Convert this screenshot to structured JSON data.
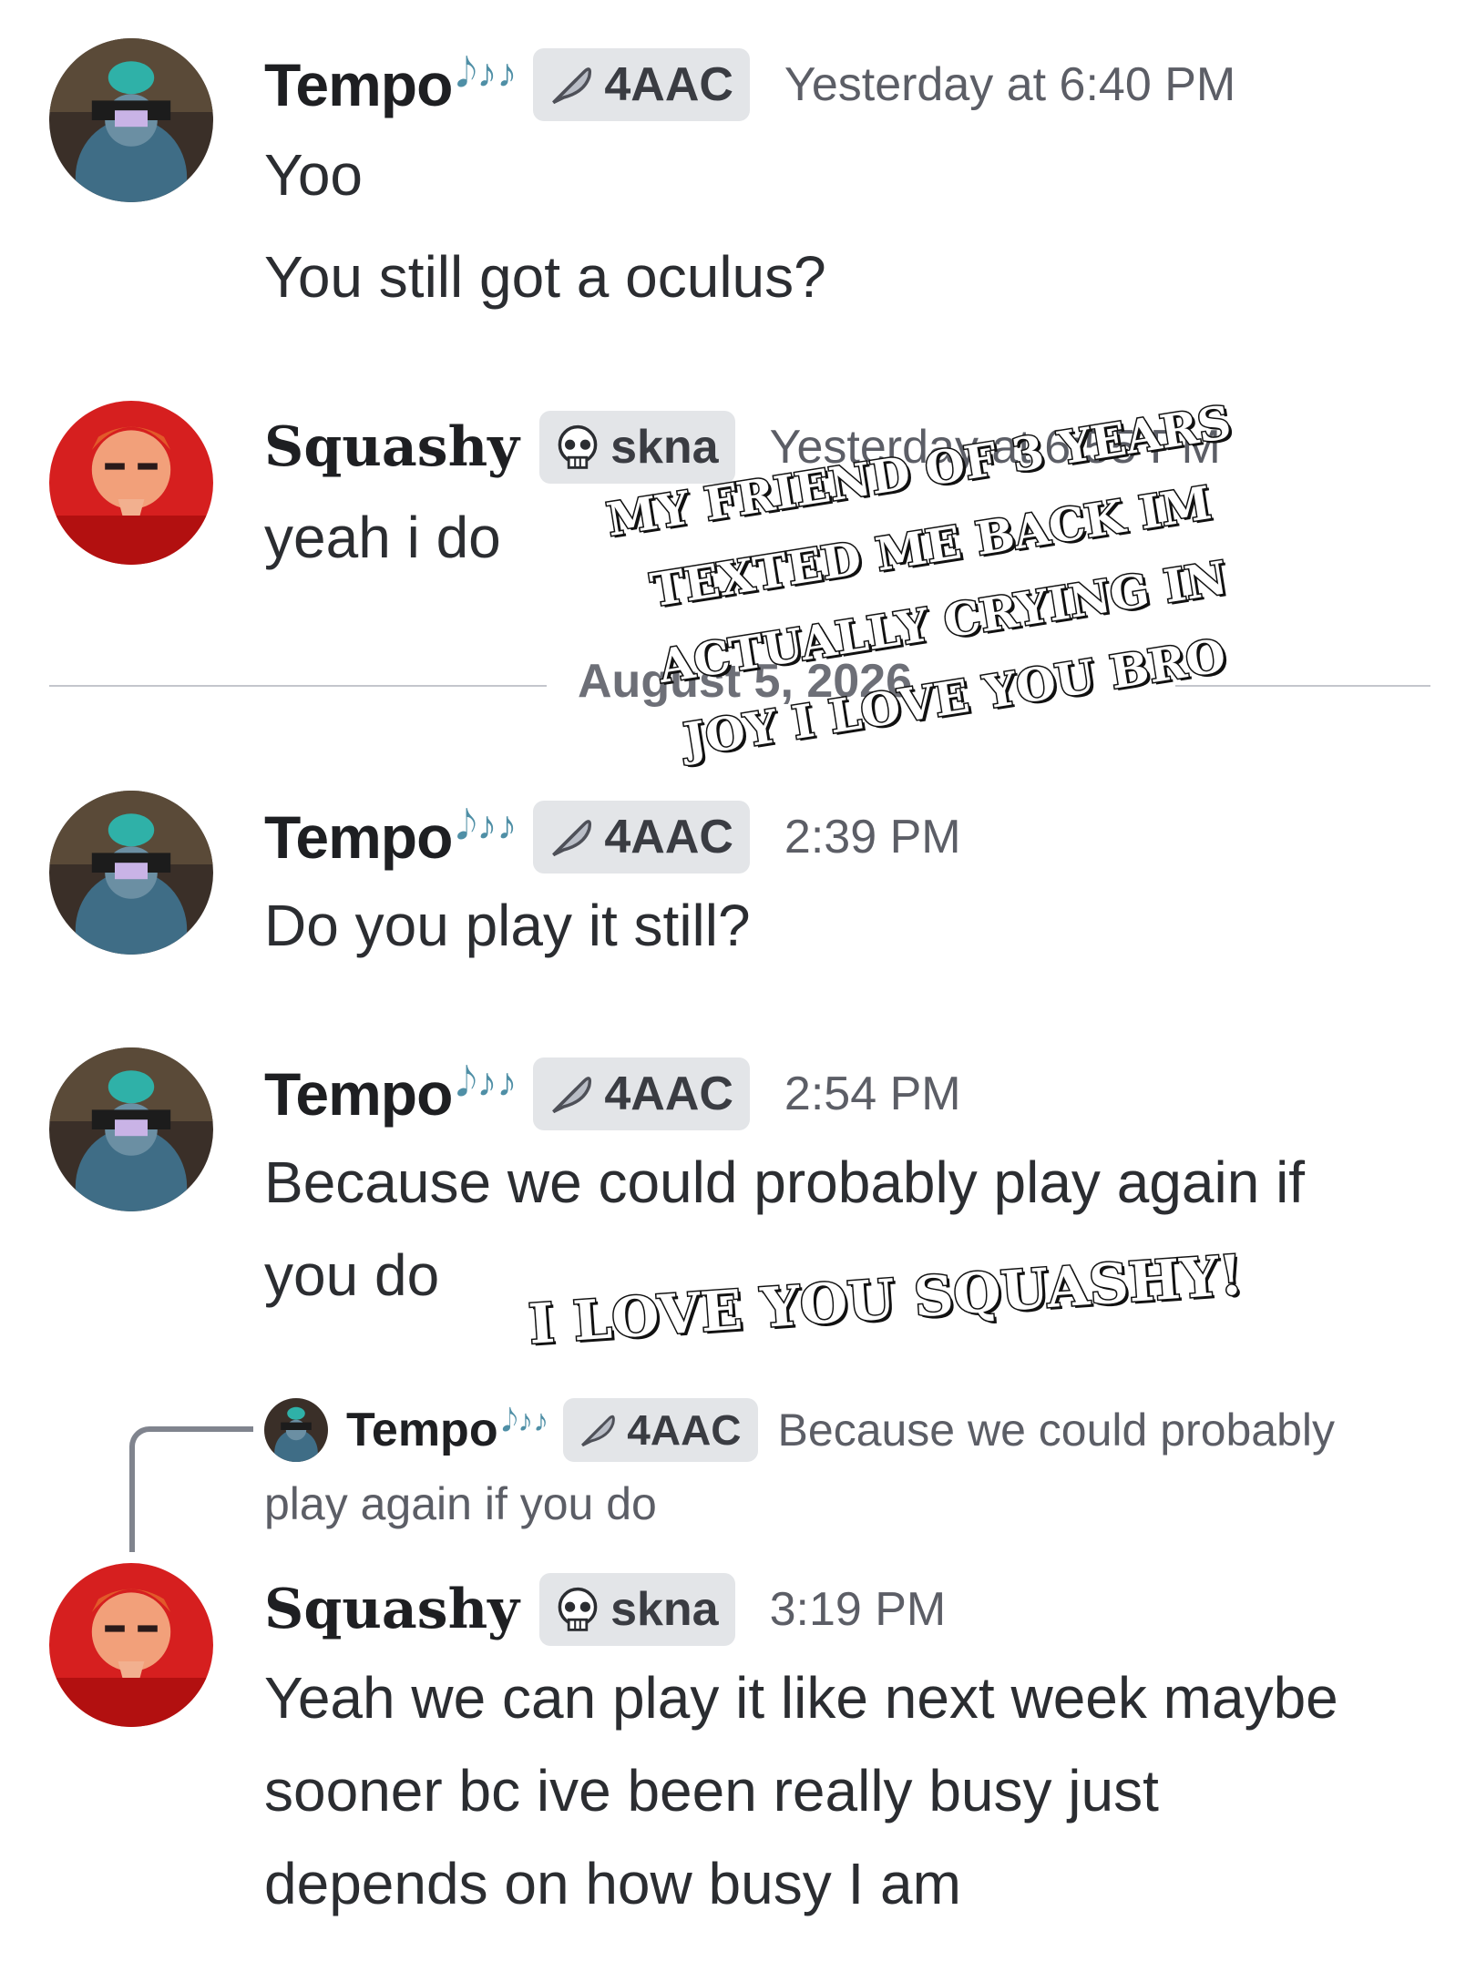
{
  "messages": [
    {
      "user": "Tempo",
      "notes": "𝅘𝅥𝅮♪♪",
      "tag": "4AAC",
      "timestamp": "Yesterday at 6:40 PM",
      "lines": [
        "Yoo",
        "You still got a oculus?"
      ]
    },
    {
      "user": "Squashy",
      "tag": "skna",
      "timestamp": "Yesterday at 6:55 PM",
      "lines": [
        "yeah i do"
      ]
    },
    {
      "user": "Tempo",
      "notes": "𝅘𝅥𝅮♪♪",
      "tag": "4AAC",
      "timestamp": "2:39 PM",
      "lines": [
        "Do you play it still?"
      ]
    },
    {
      "user": "Tempo",
      "notes": "𝅘𝅥𝅮♪♪",
      "tag": "4AAC",
      "timestamp": "2:54 PM",
      "lines": [
        "Because we could probably play again if",
        "you do"
      ]
    },
    {
      "user": "Squashy",
      "tag": "skna",
      "timestamp": "3:19 PM",
      "lines": [
        "Yeah we can play it like next week maybe",
        "sooner bc ive been really busy just",
        "depends on how busy I am"
      ]
    }
  ],
  "date_divider": "August 5, 2026",
  "reply": {
    "user": "Tempo",
    "notes": "𝅘𝅥𝅮♪♪",
    "tag": "4AAC",
    "text_line1": "Because we could probably",
    "text_line2": "play again if you do"
  },
  "overlays": {
    "caption_lines": [
      "MY FRIEND OF 3 YEARS",
      "TEXTED ME BACK IM",
      "ACTUALLY CRYING IN",
      "JOY I LOVE YOU BRO"
    ],
    "love_text": "I LOVE YOU SQUASHY!"
  },
  "icons": {
    "tempo_tag": "feather-icon",
    "squashy_tag": "skull-icon"
  },
  "colors": {
    "notes": "#4f8fa6",
    "tag_bg": "#e3e5e8",
    "timestamp": "#5c5e66"
  }
}
